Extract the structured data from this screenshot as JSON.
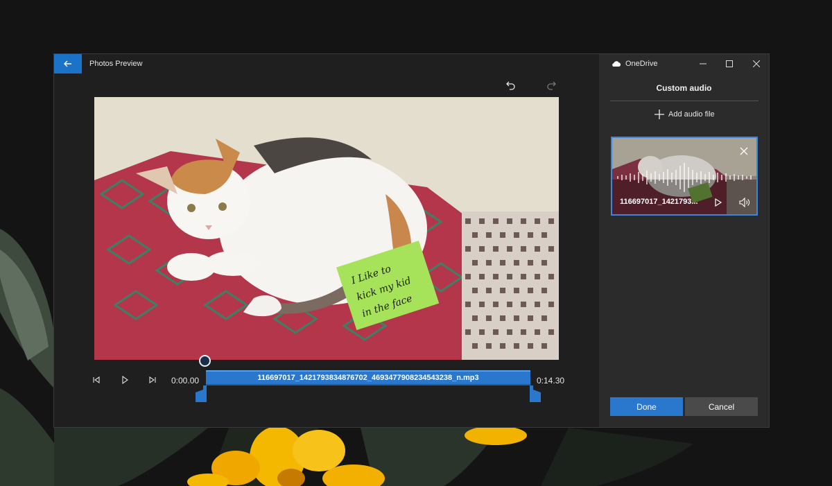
{
  "window": {
    "title": "Photos Preview"
  },
  "onedrive_label": "OneDrive",
  "panel": {
    "title": "Custom audio",
    "add_audio_label": "Add audio file"
  },
  "audio_card": {
    "file_name": "116697017_1421793..."
  },
  "timeline": {
    "start_time": "0:00.00",
    "end_time": "0:14.30",
    "track_label": "116697017_1421793834876702_4693477908234543238_n.mp3"
  },
  "note": {
    "line1": "I Like to",
    "line2": "kick my kid",
    "line3": "in the face"
  },
  "buttons": {
    "done": "Done",
    "cancel": "Cancel"
  },
  "icons": [
    "back-arrow-icon",
    "undo-icon",
    "redo-icon",
    "cloud-icon",
    "minimize-icon",
    "maximize-icon",
    "close-icon",
    "plus-icon",
    "step-back-icon",
    "play-icon",
    "step-forward-icon",
    "volume-icon"
  ],
  "colors": {
    "accent": "#2a78cd",
    "panel": "#2b2b2b",
    "window": "#1f1f1f"
  }
}
